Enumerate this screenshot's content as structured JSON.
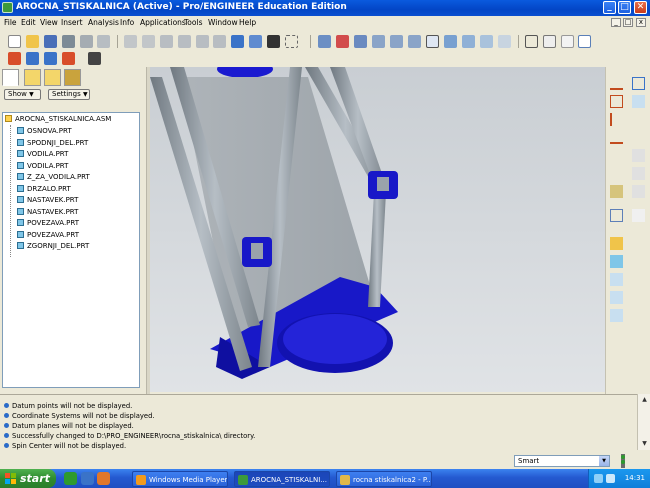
{
  "window": {
    "title": "AROCNA_STISKALNICA (Active) - Pro/ENGINEER Education Edition",
    "min_label": "_",
    "max_label": "□",
    "close_label": "✕"
  },
  "menu": {
    "items": [
      "File",
      "Edit",
      "View",
      "Insert",
      "Analysis",
      "Info",
      "Applications",
      "Tools",
      "Window",
      "Help"
    ],
    "mdi_min": "_",
    "mdi_max": "□",
    "mdi_close": "x"
  },
  "navigator": {
    "show_label": "Show",
    "settings_label": "Settings",
    "root": "AROCNA_STISKALNICA.ASM",
    "parts": [
      "OSNOVA.PRT",
      "SPODNJI_DEL.PRT",
      "VODILA.PRT",
      "VODILA.PRT",
      "Z_ZA_VODILA.PRT",
      "DRZALO.PRT",
      "NASTAVEK.PRT",
      "NASTAVEK.PRT",
      "POVEZAVA.PRT",
      "POVEZAVA.PRT",
      "ZGORNJI_DEL.PRT"
    ]
  },
  "messages": [
    "Datum points will not be displayed.",
    "Coordinate Systems will not be displayed.",
    "Datum planes will not be displayed.",
    "Successfully changed to D:\\PRO_ENGINEER\\rocna_stiskalnica\\ directory.",
    "Spin Center will not be displayed."
  ],
  "status": {
    "filter_value": "Smart"
  },
  "taskbar": {
    "start_label": "start",
    "tasks": [
      "Windows Media Player",
      "AROCNA_STISKALNI...",
      "rocna stiskalnica2 - P..."
    ],
    "clock": "14:31"
  },
  "colors": {
    "model_blue": "#1a1ad0",
    "rod_gray": "#9aa3ab",
    "panel": "#ece9d8",
    "title_blue": "#0a5ade"
  }
}
